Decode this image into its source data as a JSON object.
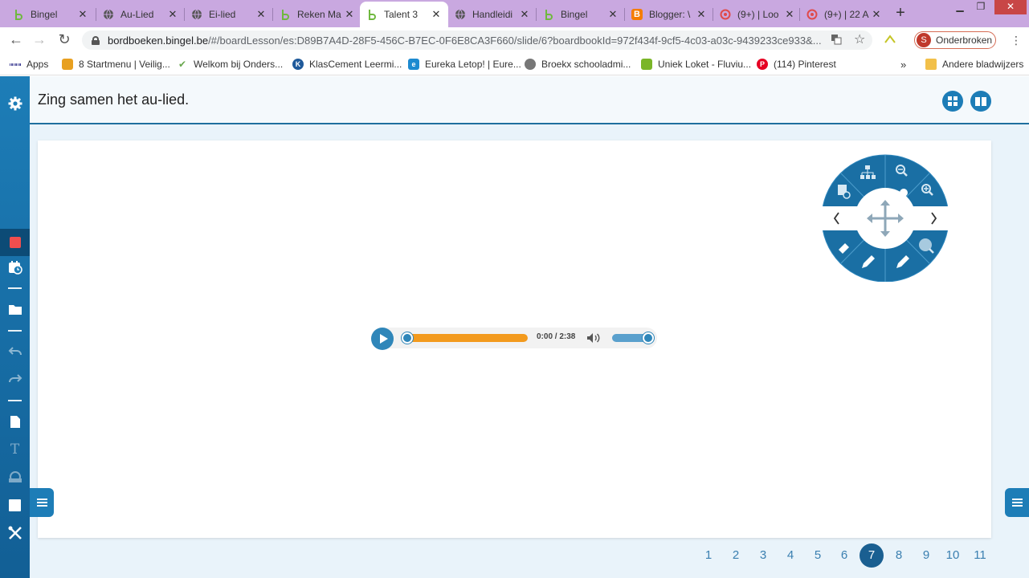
{
  "tabs": [
    {
      "title": "Bingel",
      "icon": "bingel-icon",
      "active": false
    },
    {
      "title": "Au-Lied",
      "icon": "globe-icon",
      "active": false
    },
    {
      "title": "Ei-lied",
      "icon": "globe-icon",
      "active": false
    },
    {
      "title": "Reken Ma",
      "icon": "bingel-icon",
      "active": false
    },
    {
      "title": "Talent 3",
      "icon": "bingel-icon",
      "active": true
    },
    {
      "title": "Handleidi",
      "icon": "globe-icon",
      "active": false
    },
    {
      "title": "Bingel",
      "icon": "bingel-icon",
      "active": false
    },
    {
      "title": "Blogger: \\",
      "icon": "blogger-icon",
      "active": false
    },
    {
      "title": "(9+) | Loo",
      "icon": "swirl-icon",
      "active": false
    },
    {
      "title": "(9+) | 22 A",
      "icon": "swirl-icon",
      "active": false
    }
  ],
  "address": {
    "host": "bordboeken.bingel.be",
    "path": "/#/boardLesson/es:D89B7A4D-28F5-456C-B7EC-0F6E8CA3F660/slide/6?boardbookId=972f434f-9cf5-4c03-a03c-9439233ce933&...",
    "profile_initial": "S",
    "profile_label": "Onderbroken"
  },
  "bookmarks": [
    {
      "label": "Apps",
      "icon": "apps-grid-icon"
    },
    {
      "label": "8 Startmenu | Veilig...",
      "icon": "startmenu-icon"
    },
    {
      "label": "Welkom bij Onders...",
      "icon": "leaf-icon"
    },
    {
      "label": "KlasCement Leermi...",
      "icon": "klascement-icon"
    },
    {
      "label": "Eureka Letop! | Eure...",
      "icon": "eureka-icon"
    },
    {
      "label": "Broekx schooladmi...",
      "icon": "broekx-icon"
    },
    {
      "label": "Uniek Loket - Fluviu...",
      "icon": "loket-icon"
    },
    {
      "label": "(114) Pinterest",
      "icon": "pinterest-icon"
    }
  ],
  "bookmarks_more": "»",
  "other_bookmarks": "Andere bladwijzers",
  "lesson": {
    "title": "Zing samen het au-lied."
  },
  "player": {
    "time": "0:00 / 2:38",
    "progress": 0.0,
    "volume": 1.0
  },
  "pager": {
    "pages": [
      "1",
      "2",
      "3",
      "4",
      "5",
      "6",
      "7",
      "8",
      "9",
      "10",
      "11"
    ],
    "active": "7"
  }
}
